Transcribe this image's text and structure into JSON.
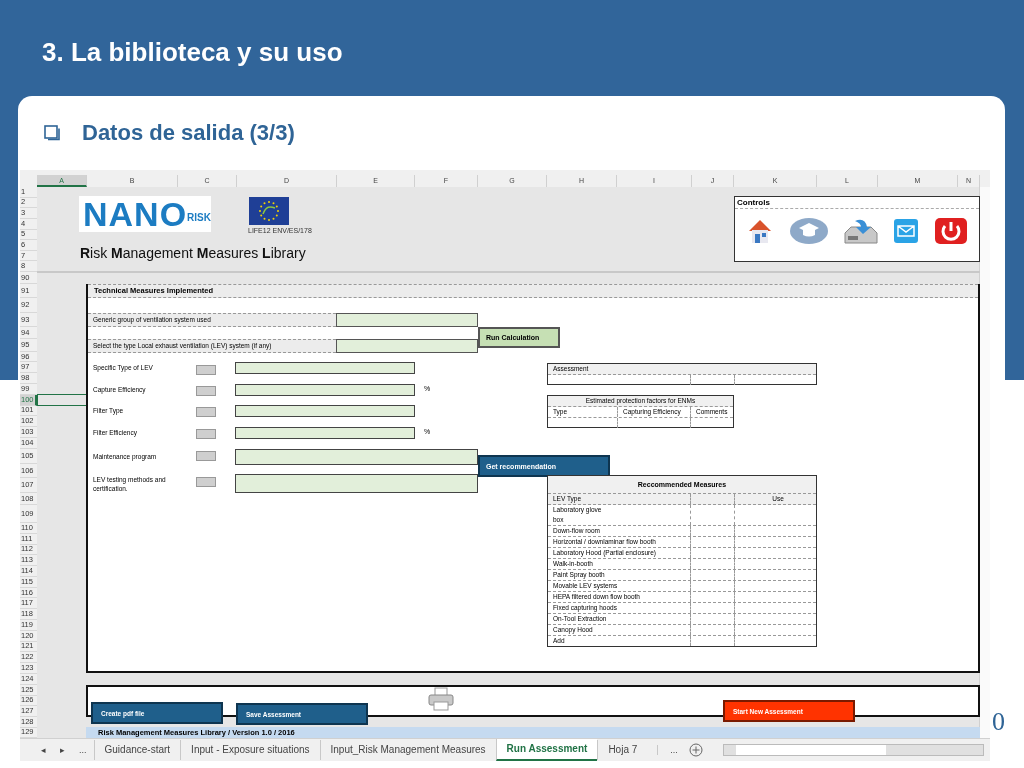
{
  "slide": {
    "title": "3. La biblioteca y su uso",
    "heading": "Datos de salida (3/3)",
    "page_number": "0"
  },
  "sheet": {
    "columns": [
      {
        "label": "A",
        "selected": true
      },
      {
        "label": "B",
        "selected": false
      },
      {
        "label": "C",
        "selected": false
      },
      {
        "label": "D",
        "selected": false
      },
      {
        "label": "E",
        "selected": false
      },
      {
        "label": "F",
        "selected": false
      },
      {
        "label": "G",
        "selected": false
      },
      {
        "label": "H",
        "selected": false
      },
      {
        "label": "I",
        "selected": false
      },
      {
        "label": "J",
        "selected": false
      },
      {
        "label": "K",
        "selected": false
      },
      {
        "label": "L",
        "selected": false
      },
      {
        "label": "M",
        "selected": false
      },
      {
        "label": "N",
        "selected": false
      }
    ],
    "rows": [
      {
        "label": "1",
        "selected": false
      },
      {
        "label": "2",
        "selected": false
      },
      {
        "label": "3",
        "selected": false
      },
      {
        "label": "4",
        "selected": false
      },
      {
        "label": "5",
        "selected": false
      },
      {
        "label": "6",
        "selected": false
      },
      {
        "label": "7",
        "selected": false
      },
      {
        "label": "8",
        "selected": false
      },
      {
        "label": "90",
        "selected": false
      },
      {
        "label": "91",
        "selected": false
      },
      {
        "label": "92",
        "selected": false
      },
      {
        "label": "93",
        "selected": false
      },
      {
        "label": "94",
        "selected": false
      },
      {
        "label": "95",
        "selected": false
      },
      {
        "label": "96",
        "selected": false
      },
      {
        "label": "97",
        "selected": false
      },
      {
        "label": "98",
        "selected": false
      },
      {
        "label": "99",
        "selected": false
      },
      {
        "label": "100",
        "selected": true
      },
      {
        "label": "101",
        "selected": false
      },
      {
        "label": "102",
        "selected": false
      },
      {
        "label": "103",
        "selected": false
      },
      {
        "label": "104",
        "selected": false
      },
      {
        "label": "105",
        "selected": false
      },
      {
        "label": "106",
        "selected": false
      },
      {
        "label": "107",
        "selected": false
      },
      {
        "label": "108",
        "selected": false
      },
      {
        "label": "109",
        "selected": false
      },
      {
        "label": "110",
        "selected": false
      },
      {
        "label": "111",
        "selected": false
      },
      {
        "label": "112",
        "selected": false
      },
      {
        "label": "113",
        "selected": false
      },
      {
        "label": "114",
        "selected": false
      },
      {
        "label": "115",
        "selected": false
      },
      {
        "label": "116",
        "selected": false
      },
      {
        "label": "117",
        "selected": false
      },
      {
        "label": "118",
        "selected": false
      },
      {
        "label": "119",
        "selected": false
      },
      {
        "label": "120",
        "selected": false
      },
      {
        "label": "121",
        "selected": false
      },
      {
        "label": "122",
        "selected": false
      },
      {
        "label": "123",
        "selected": false
      },
      {
        "label": "124",
        "selected": false
      },
      {
        "label": "125",
        "selected": false
      },
      {
        "label": "126",
        "selected": false
      },
      {
        "label": "127",
        "selected": false
      },
      {
        "label": "128",
        "selected": false
      },
      {
        "label": "129",
        "selected": false
      }
    ],
    "logo": {
      "main": "NANO",
      "sub": "RISK"
    },
    "project_code": "LIFE12 ENV/ES/178",
    "library_title": "**R**isk **M**anagement **M**easures **L**ibrary",
    "controls": {
      "title": "Controls",
      "buttons": [
        {
          "kind": "home"
        },
        {
          "kind": "tutorial"
        },
        {
          "kind": "download"
        },
        {
          "kind": "mail"
        },
        {
          "kind": "power"
        }
      ]
    },
    "section_title": "Technical Measures Implemented",
    "selects": [
      {
        "label": "Generic group of ventilation system used"
      },
      {
        "label": "Select the type Local exhaust ventilation (LEV) system (if any)"
      }
    ],
    "run_button": "Run Calculation",
    "parameters": [
      {
        "label": "Specific Type of LEV",
        "kind": "short"
      },
      {
        "label": "Capture Efficiency",
        "kind": "short",
        "unit": "%"
      },
      {
        "label": "Filter Type",
        "kind": "short"
      },
      {
        "label": "Filter Efficiency",
        "kind": "short",
        "unit": "%"
      },
      {
        "label": "Maintenance program",
        "kind": "long"
      },
      {
        "label": "LEV testing methods and certification.",
        "kind": "long"
      }
    ],
    "recommend_button": "Get recommendation",
    "assessment_table": {
      "title": "Assessment"
    },
    "protection_table": {
      "title": "Estimated protection factors for ENMs",
      "columns": [
        "Type",
        "Capturing Efficiency",
        "Comments"
      ]
    },
    "measures_table": {
      "title": "Reccommended Measures",
      "type_heading": "LEV Type",
      "use_heading": "Use",
      "rows": [
        "Laboratory glove box",
        "Down-flow room",
        "Horizontal / downlaminar flow booth",
        "Laboratory Hood (Partial enclosure)",
        "Walk-in-booth",
        "Paint Spray booth",
        "Movable LEV systems",
        "HEPA filtered down flow booth",
        "Fixed capturing hoods",
        "On-Tool Extraction",
        "Canopy Hood",
        "Add"
      ]
    },
    "action_buttons": [
      {
        "label": "Create pdf file",
        "kind": "primary"
      },
      {
        "label": "Save Assessment",
        "kind": "primary"
      },
      {
        "label": "Start New Assessment",
        "kind": "danger"
      }
    ],
    "footer": "Risk Management Measures Library / Version 1.0 / 2016",
    "tab_nav": [
      "◂",
      "▸",
      "..."
    ],
    "tabs": [
      {
        "label": "Guidance-start",
        "selected": false
      },
      {
        "label": "Input - Exposure situations",
        "selected": false
      },
      {
        "label": "Input_Risk Management Measures",
        "selected": false
      },
      {
        "label": "Run Assessment",
        "selected": true
      },
      {
        "label": "Hoja 7",
        "selected": false
      }
    ],
    "tab_more": "..."
  }
}
